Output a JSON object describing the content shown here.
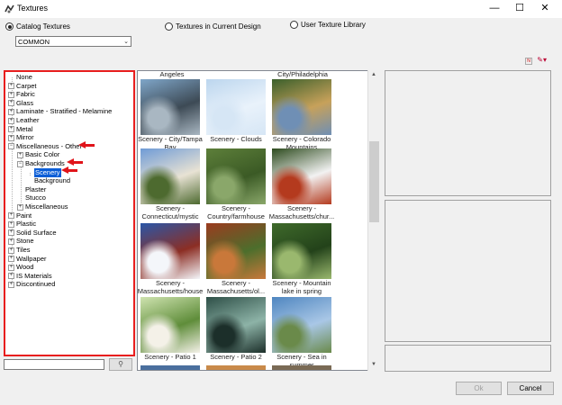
{
  "window": {
    "title": "Textures",
    "minimize_icon": "minimize-icon",
    "maximize_icon": "maximize-icon",
    "close_icon": "close-icon"
  },
  "source_options": [
    {
      "label": "Catalog Textures",
      "selected": true
    },
    {
      "label": "Textures in Current Design",
      "selected": false
    },
    {
      "label": "User Texture Library",
      "selected": false
    }
  ],
  "catalog_select": {
    "value": "COMMON"
  },
  "tree": [
    {
      "label": "None",
      "level": 0,
      "expander": ""
    },
    {
      "label": "Carpet",
      "level": 0,
      "expander": "+"
    },
    {
      "label": "Fabric",
      "level": 0,
      "expander": "+"
    },
    {
      "label": "Glass",
      "level": 0,
      "expander": "+"
    },
    {
      "label": "Laminate - Stratified - Melamine",
      "level": 0,
      "expander": "+"
    },
    {
      "label": "Leather",
      "level": 0,
      "expander": "+"
    },
    {
      "label": "Metal",
      "level": 0,
      "expander": "+"
    },
    {
      "label": "Mirror",
      "level": 0,
      "expander": "+"
    },
    {
      "label": "Miscellaneous - Other",
      "level": 0,
      "expander": "−"
    },
    {
      "label": "Basic Color",
      "level": 1,
      "expander": "+"
    },
    {
      "label": "Backgrounds",
      "level": 1,
      "expander": "−"
    },
    {
      "label": "Scenery",
      "level": 2,
      "expander": "",
      "selected": true
    },
    {
      "label": "Background",
      "level": 2,
      "expander": ""
    },
    {
      "label": "Plaster",
      "level": 1,
      "expander": ""
    },
    {
      "label": "Stucco",
      "level": 1,
      "expander": ""
    },
    {
      "label": "Miscellaneous",
      "level": 1,
      "expander": "+"
    },
    {
      "label": "Paint",
      "level": 0,
      "expander": "+"
    },
    {
      "label": "Plastic",
      "level": 0,
      "expander": "+"
    },
    {
      "label": "Solid Surface",
      "level": 0,
      "expander": "+"
    },
    {
      "label": "Stone",
      "level": 0,
      "expander": "+"
    },
    {
      "label": "Tiles",
      "level": 0,
      "expander": "+"
    },
    {
      "label": "Wallpaper",
      "level": 0,
      "expander": "+"
    },
    {
      "label": "Wood",
      "level": 0,
      "expander": "+"
    },
    {
      "label": "IS Materials",
      "level": 0,
      "expander": "+"
    },
    {
      "label": "Discontinued",
      "level": 0,
      "expander": "+"
    }
  ],
  "search": {
    "value": "",
    "button_icon": "search-icon"
  },
  "gallery": {
    "top_captions": [
      "Angeles",
      "",
      "City/Philadelphia"
    ],
    "items": [
      {
        "caption": "Scenery - City/Tampa Bay",
        "colors": [
          "#7fa6c9",
          "#3d4a55",
          "#a9b7c2"
        ]
      },
      {
        "caption": "Scenery - Clouds",
        "colors": [
          "#bcd6ee",
          "#e9f2fb",
          "#d6e6f5"
        ]
      },
      {
        "caption": "Scenery - Colorado Mountains",
        "colors": [
          "#3a5f2b",
          "#c7a15a",
          "#6f8fb5"
        ]
      },
      {
        "caption": "Scenery - Connecticut/mystic",
        "colors": [
          "#6f9bd6",
          "#e8e2d4",
          "#4d6a2f"
        ]
      },
      {
        "caption": "Scenery - Country/farmhouse",
        "colors": [
          "#5d7f3a",
          "#3b5a25",
          "#8aa76a"
        ]
      },
      {
        "caption": "Scenery - Massachusetts/chur...",
        "colors": [
          "#2d4b1e",
          "#f2f2f2",
          "#b43a1e"
        ]
      },
      {
        "caption": "Scenery - Massachusetts/house",
        "colors": [
          "#2a57a8",
          "#8c2e24",
          "#f4f6fa"
        ]
      },
      {
        "caption": "Scenery - Massachusetts/ol...",
        "colors": [
          "#9b3b1f",
          "#4c6e2c",
          "#c9783a"
        ]
      },
      {
        "caption": "Scenery - Mountain lake in spring",
        "colors": [
          "#3f6a2b",
          "#23421a",
          "#9ab86e"
        ]
      },
      {
        "caption": "Scenery - Patio 1",
        "colors": [
          "#cfe3b0",
          "#5f8d3a",
          "#f4f1e8"
        ]
      },
      {
        "caption": "Scenery - Patio 2",
        "colors": [
          "#2e4f47",
          "#8db3a7",
          "#1c2f2a"
        ]
      },
      {
        "caption": "Scenery - Sea in summer",
        "colors": [
          "#4f86c0",
          "#a9c7e6",
          "#6a8a4a"
        ]
      }
    ]
  },
  "toolbar_icons": [
    "select-all-icon",
    "paint-icon"
  ],
  "buttons": {
    "ok": "Ok",
    "cancel": "Cancel"
  }
}
